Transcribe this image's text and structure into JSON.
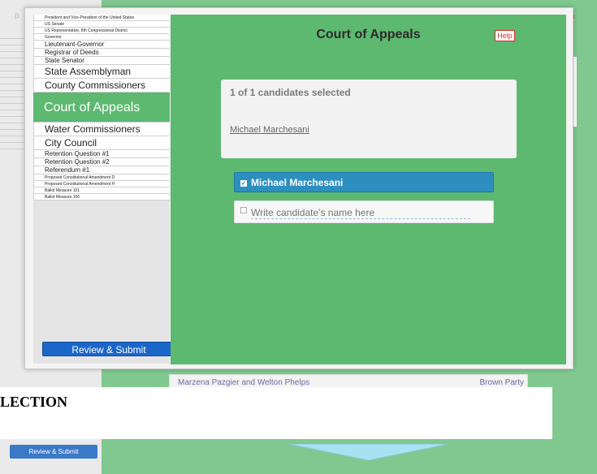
{
  "background": {
    "logo_letter": "p",
    "close_glyph": "x",
    "tiny_list": [
      "",
      "",
      "",
      "",
      "",
      "",
      "",
      "",
      "",
      "",
      "",
      "",
      "",
      "",
      "",
      "",
      "",
      ""
    ],
    "candidate_row": {
      "name": "Marzena Pazgier and Welton Phelps",
      "party": "Brown Party"
    },
    "election_text": "LECTION",
    "review_label": "Review & Submit"
  },
  "sidebar": {
    "races": [
      {
        "label": "President and Vice-President of the United States",
        "size": "tiny"
      },
      {
        "label": "US Senate",
        "size": "tiny"
      },
      {
        "label": "US Representative, 6th Congressional District",
        "size": "tiny"
      },
      {
        "label": "Governor",
        "size": "tiny"
      },
      {
        "label": "Lieutenant-Governor",
        "size": "small"
      },
      {
        "label": "Registrar of Deeds",
        "size": "small"
      },
      {
        "label": "State Senator",
        "size": "small"
      },
      {
        "label": "State Assemblyman",
        "size": "medium"
      },
      {
        "label": "County Commissioners",
        "size": "medium"
      },
      {
        "label": "Court of Appeals",
        "size": "active"
      },
      {
        "label": "Water Commissioners",
        "size": "medium"
      },
      {
        "label": "City Council",
        "size": "medium"
      },
      {
        "label": "Retention Question #1",
        "size": "small"
      },
      {
        "label": "Retention Question #2",
        "size": "small"
      },
      {
        "label": "Referendum #1",
        "size": "small"
      },
      {
        "label": "Proposed Constitutional Amendment D",
        "size": "tiny"
      },
      {
        "label": "Proposed Constitutional Amendment H",
        "size": "tiny"
      },
      {
        "label": "Ballot Measure 101",
        "size": "tiny"
      },
      {
        "label": "Ballot Measure 106",
        "size": "tiny"
      }
    ],
    "review_label": "Review & Submit"
  },
  "main": {
    "title": "Court of Appeals",
    "help_label": "Help",
    "summary": {
      "count_text": "1 of 1 candidates selected",
      "selected_name": "Michael Marchesani"
    },
    "options": [
      {
        "label": "Michael Marchesani",
        "checked": true
      }
    ],
    "writein": {
      "placeholder": "Write candidate's name here",
      "checked": false
    }
  },
  "colors": {
    "accent_green": "#5db870",
    "selected_blue": "#2d8fbf",
    "review_blue": "#1b66c9",
    "help_red": "#d62b2b"
  }
}
